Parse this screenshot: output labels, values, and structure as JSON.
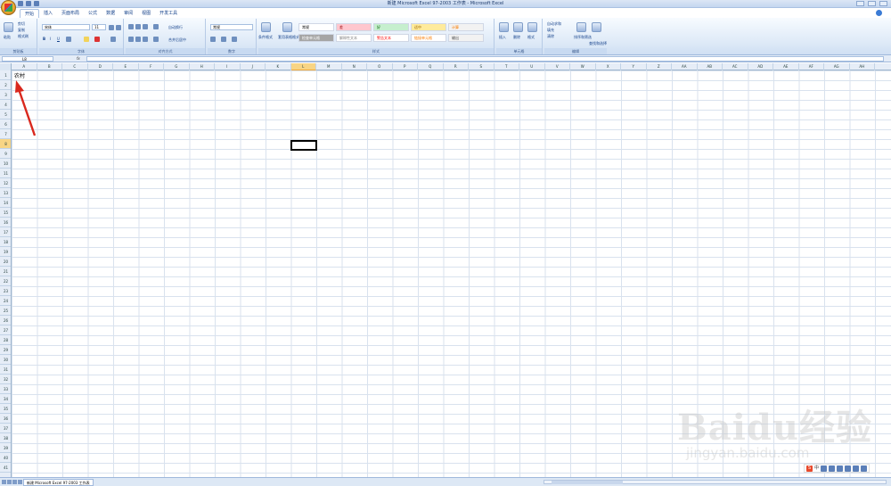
{
  "window": {
    "title": "新建 Microsoft Excel 97-2003 工作表 - Microsoft Excel"
  },
  "tabs": [
    "开始",
    "插入",
    "页面布局",
    "公式",
    "数据",
    "审阅",
    "视图",
    "开发工具"
  ],
  "ribbon": {
    "clipboard": {
      "label": "剪贴板",
      "paste": "粘贴",
      "cut": "剪切",
      "copy": "复制",
      "painter": "格式刷"
    },
    "font": {
      "label": "字体",
      "name": "宋体",
      "size": "11"
    },
    "alignment": {
      "label": "对齐方式",
      "wrap": "自动换行",
      "merge": "合并后居中"
    },
    "number": {
      "label": "数字",
      "format": "常规"
    },
    "styles": {
      "label": "样式",
      "cond": "条件格式",
      "table": "套用表格格式",
      "cells": [
        {
          "text": "常规",
          "bg": "#ffffff",
          "color": "#000000"
        },
        {
          "text": "差",
          "bg": "#ffc7ce",
          "color": "#9c0006"
        },
        {
          "text": "好",
          "bg": "#c6efce",
          "color": "#006100"
        },
        {
          "text": "适中",
          "bg": "#ffeb9c",
          "color": "#9c6500"
        },
        {
          "text": "计算",
          "bg": "#f2f2f2",
          "color": "#fa7d00"
        },
        {
          "text": "检查单元格",
          "bg": "#a5a5a5",
          "color": "#ffffff"
        },
        {
          "text": "解释性文本",
          "bg": "#ffffff",
          "color": "#7f7f7f"
        },
        {
          "text": "警告文本",
          "bg": "#ffffff",
          "color": "#ff0000"
        },
        {
          "text": "链接单元格",
          "bg": "#ffffff",
          "color": "#fa7d00"
        },
        {
          "text": "输出",
          "bg": "#f2f2f2",
          "color": "#3f3f3f"
        }
      ]
    },
    "cells": {
      "label": "单元格",
      "insert": "插入",
      "delete": "删除",
      "format": "格式"
    },
    "editing": {
      "label": "编辑",
      "autosum": "自动求和",
      "fill": "填充",
      "clear": "清除",
      "sort": "排序和筛选",
      "find": "查找和选择"
    }
  },
  "namebox": "L8",
  "fx": "fx",
  "columns": [
    "A",
    "B",
    "C",
    "D",
    "E",
    "F",
    "G",
    "H",
    "I",
    "J",
    "K",
    "L",
    "M",
    "N",
    "O",
    "P",
    "Q",
    "R",
    "S",
    "T",
    "U",
    "V",
    "W",
    "X",
    "Y",
    "Z",
    "AA",
    "AB",
    "AC",
    "AD",
    "AE",
    "AF",
    "AG",
    "AH"
  ],
  "selected_column": "L",
  "selected_row": "8",
  "rows": [
    "1",
    "2",
    "3",
    "4",
    "5",
    "6",
    "7",
    "8",
    "9",
    "10",
    "11",
    "12",
    "13",
    "14",
    "15",
    "16",
    "17",
    "18",
    "19",
    "20",
    "21",
    "22",
    "23",
    "24",
    "25",
    "26",
    "27",
    "28",
    "29",
    "30",
    "31",
    "32",
    "33",
    "34",
    "35",
    "36",
    "37",
    "38",
    "39",
    "40",
    "41"
  ],
  "cell_a1": "农村",
  "sheet_tab": "新建 Microsoft Excel 97-2003 工作表",
  "ime": {
    "label": "中"
  },
  "watermark": {
    "text": "Baidu经验",
    "url": "jingyan.baidu.com"
  },
  "colors": {
    "arrow": "#d9281e",
    "active": "#f8d585"
  }
}
